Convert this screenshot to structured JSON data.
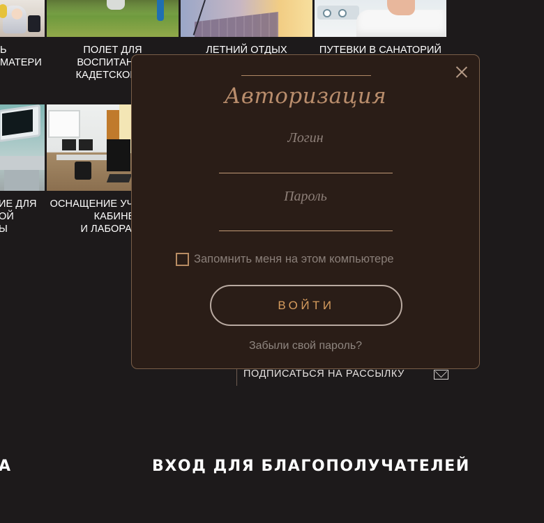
{
  "cards_row1": [
    {
      "lines": [
        "Ь",
        "МАТЕРИ"
      ]
    },
    {
      "lines": [
        "ПОЛЕТ ДЛЯ",
        "ВОСПИТАННИ",
        "КАДЕТСКОЙ Ш"
      ]
    },
    {
      "lines": [
        "ЛЕТНИЙ ОТДЫХ"
      ]
    },
    {
      "lines": [
        "ПУТЕВКИ В САНАТОРИЙ"
      ]
    }
  ],
  "cards_row2": [
    {
      "lines": [
        "ИЕ ДЛЯ",
        "ОЙ",
        "Ы"
      ]
    },
    {
      "lines": [
        "ОСНАЩЕНИЕ УЧ",
        "КАБИНЕТ",
        "И ЛАБОРАТО"
      ]
    }
  ],
  "modal": {
    "title": "Авторизация",
    "login_label": "Логин",
    "password_label": "Пароль",
    "remember_label": "Запомнить меня на этом компьютере",
    "login_button": "ВОЙТИ",
    "forgot_link": "Забыли свой пароль?"
  },
  "subscribe": {
    "label": "ПОДПИСАТЬСЯ НА РАССЫЛКУ",
    "icon": "mail-icon"
  },
  "bottom": {
    "left_heading": "А",
    "center_heading": "ВХОД ДЛЯ БЛАГОПОЛУЧАТЕЛЕЙ"
  },
  "colors": {
    "background": "#1d1a1b",
    "modal_bg": "#2a1d17",
    "accent": "#b98d6c",
    "button_text": "#d69c5e"
  }
}
